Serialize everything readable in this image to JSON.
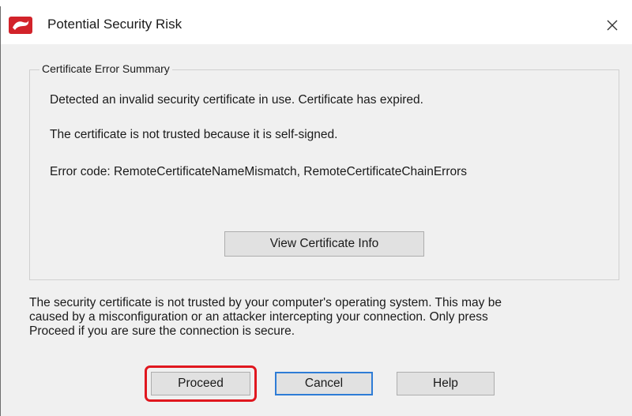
{
  "window": {
    "title": "Potential Security Risk",
    "close_icon": "close-icon",
    "app_icon": "app-logo-icon"
  },
  "summary": {
    "legend": "Certificate Error Summary",
    "line1": "Detected an invalid security certificate in use. Certificate has expired.",
    "line2": "The certificate is not trusted because it is self-signed.",
    "line3": "Error code: RemoteCertificateNameMismatch, RemoteCertificateChainErrors",
    "view_button": "View Certificate Info"
  },
  "footer": {
    "line1": "The security certificate is not trusted by your computer's operating system. This may be",
    "line2": "caused by a misconfiguration or an attacker intercepting your connection. Only press",
    "line3": "Proceed if you are sure the connection is secure."
  },
  "buttons": {
    "proceed": "Proceed",
    "cancel": "Cancel",
    "help": "Help"
  },
  "colors": {
    "highlight": "#e0171f",
    "focus": "#2e7cd6",
    "brand": "#d2232a"
  }
}
